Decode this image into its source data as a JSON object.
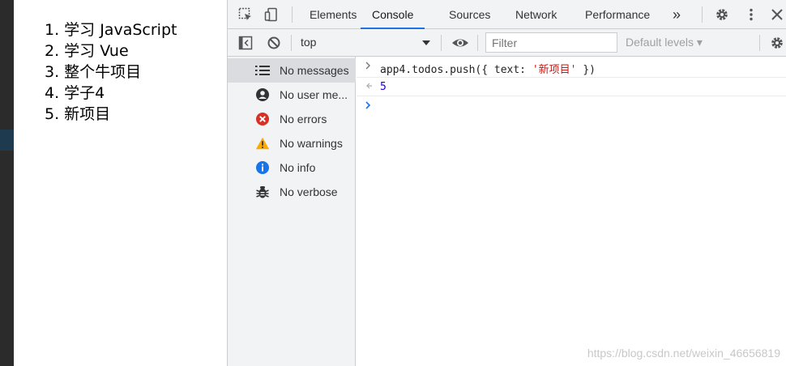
{
  "page": {
    "todos": [
      "1. 学习 JavaScript",
      "2. 学习 Vue",
      "3. 整个牛项目",
      "4. 学子4",
      "5. 新项目"
    ]
  },
  "devtools": {
    "tabs": [
      {
        "label": "Elements",
        "active": false
      },
      {
        "label": "Console",
        "active": true
      },
      {
        "label": "Sources",
        "active": false
      },
      {
        "label": "Network",
        "active": false
      },
      {
        "label": "Performance",
        "active": false
      }
    ],
    "more_tabs_label": "»",
    "toolbar": {
      "context": "top",
      "filter_placeholder": "Filter",
      "levels_label": "Default levels ▾"
    },
    "sidebar": [
      {
        "label": "No messages",
        "icon": "list-icon"
      },
      {
        "label": "No user me...",
        "icon": "user-icon"
      },
      {
        "label": "No errors",
        "icon": "error-icon"
      },
      {
        "label": "No warnings",
        "icon": "warning-icon"
      },
      {
        "label": "No info",
        "icon": "info-icon"
      },
      {
        "label": "No verbose",
        "icon": "bug-icon"
      }
    ],
    "console": {
      "input_prefix": "app4.todos.push({ text: ",
      "input_string": "'新项目'",
      "input_suffix": " })",
      "result": "5"
    },
    "accent_color": "#1a73e8"
  },
  "watermark": "https://blog.csdn.net/weixin_46656819"
}
